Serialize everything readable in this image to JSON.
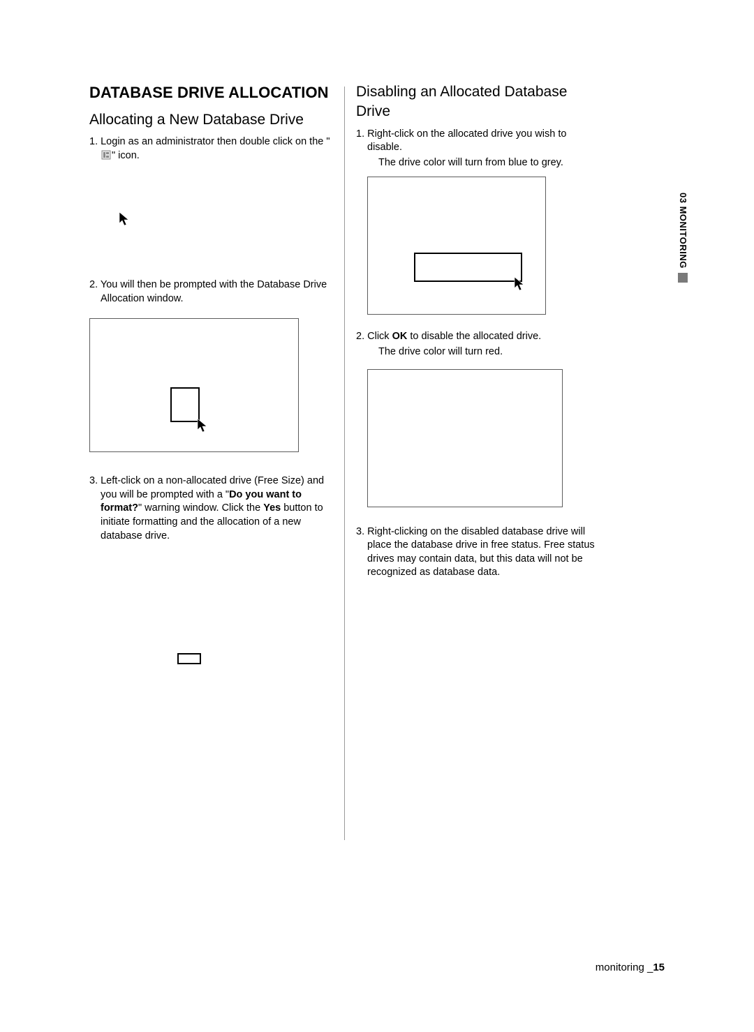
{
  "section_tab": "03 MONITORING",
  "footer": {
    "label": "monitoring _",
    "page_num": "15"
  },
  "left": {
    "h1": "DATABASE DRIVE ALLOCATION",
    "h2": "Allocating a New Database Drive",
    "step1_prefix": "1.  Login as an administrator then double click on the \"",
    "step1_suffix": "\" icon.",
    "step2": "2. You will then be prompted with the Database Drive Allocation window.",
    "step3_a": "3. Left-click on a non-allocated drive (Free Size) and you will be prompted with a \"",
    "step3_bold1": "Do you want to format?",
    "step3_b": "\" warning window. Click the ",
    "step3_bold2": "Yes",
    "step3_c": " button to initiate formatting and the allocation of a new database drive."
  },
  "right": {
    "h2": "Disabling an Allocated Database Drive",
    "step1_a": "1. Right-click on the allocated drive you wish to disable.",
    "step1_b": "The drive color will turn from blue to grey.",
    "step2_a": "2. Click ",
    "step2_bold": "OK",
    "step2_b": " to disable the allocated drive.",
    "step2_c": "The drive color will turn red.",
    "step3": "3. Right-clicking on the disabled database drive will place the database drive in free status. Free status drives may contain data, but this data will not be recognized as database data."
  }
}
